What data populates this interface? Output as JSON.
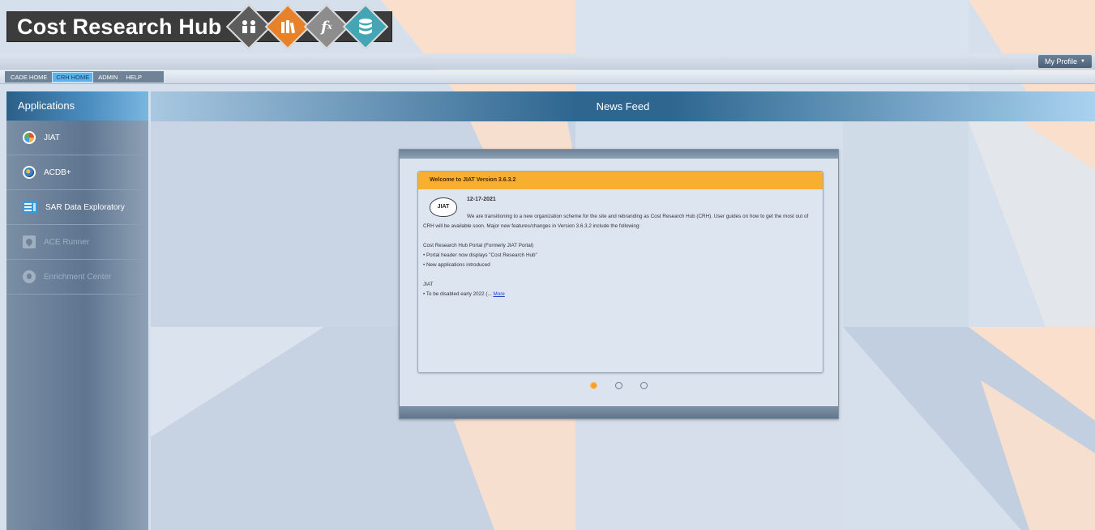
{
  "header": {
    "title": "Cost Research Hub",
    "logo_icons": [
      "people-icon",
      "books-icon",
      "function-icon",
      "database-icon"
    ]
  },
  "profile": {
    "label": "My Profile",
    "caret": "▼"
  },
  "nav": {
    "items": [
      {
        "label": "CADE HOME",
        "active": false
      },
      {
        "label": "CRH HOME",
        "active": true
      },
      {
        "label": "ADMIN",
        "active": false
      },
      {
        "label": "HELP",
        "active": false
      }
    ]
  },
  "sidebar": {
    "title": "Applications",
    "items": [
      {
        "label": "JIAT",
        "icon": "jiat-icon",
        "enabled": true
      },
      {
        "label": "ACDB+",
        "icon": "acdb-icon",
        "enabled": true
      },
      {
        "label": "SAR Data Exploratory",
        "icon": "sar-icon",
        "enabled": true
      },
      {
        "label": "ACE Runner",
        "icon": "ace-runner-icon",
        "enabled": false
      },
      {
        "label": "Enrichment Center",
        "icon": "enrichment-icon",
        "enabled": false
      }
    ]
  },
  "news": {
    "header": "News Feed",
    "card": {
      "title": "Welcome to JIAT Version 3.6.3.2",
      "badge": "JIAT",
      "date": "12-17-2021",
      "intro": "We are transitioning to a new organization scheme for the site and rebranding as Cost Research Hub (CRH). User guides on how to get the most out of CRH will be available soon. Major new features/changes in Version 3.6.3.2 include the following:",
      "section1_title": "Cost Research Hub Portal (Formerly JIAT Portal)",
      "section1_items": [
        "• Portal header now displays \"Cost Research Hub\"",
        "• New applications introduced"
      ],
      "section2_title": "JIAT",
      "section2_item": "• To be disabled early 2022 (...",
      "more_label": "More"
    },
    "pager": {
      "count": 3,
      "active": 0
    }
  },
  "colors": {
    "accent_orange": "#f8ae2f",
    "sidebar_header": "#2b5f88",
    "news_header": "#2e6690"
  }
}
